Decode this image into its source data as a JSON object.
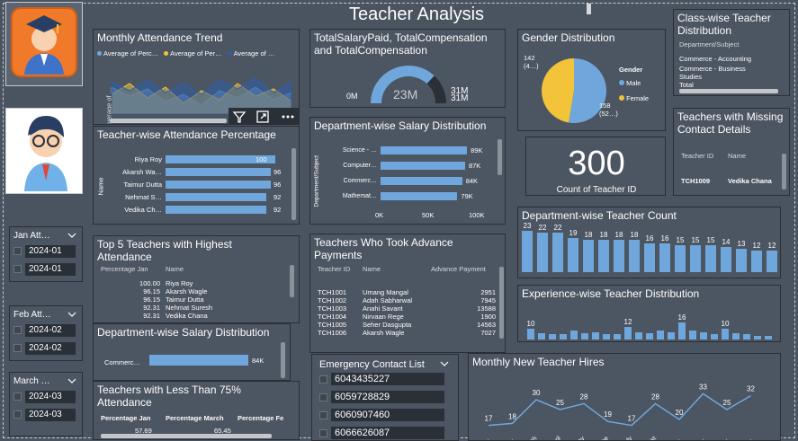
{
  "title": "Teacher Analysis",
  "colors": {
    "blue": "#6fa7dd",
    "yellow": "#f3c33a",
    "dark": "#2a3038",
    "gauge": "#6fa7dd"
  },
  "attendance": {
    "title": "Monthly Attendance Trend",
    "legend": [
      "Average of Perc…",
      "Average of Per…",
      "Average of …"
    ],
    "ylabel": "Average of …"
  },
  "salarypaid": {
    "title": "TotalSalaryPaid, TotalCompensation and TotalCompensation",
    "min": "0M",
    "val": "23M",
    "max1": "31M",
    "max2": "31M",
    "fraction": 0.74
  },
  "gender": {
    "title": "Gender Distribution",
    "legend_title": "Gender",
    "items": [
      {
        "name": "Male",
        "count": "158",
        "pct": "(52…)",
        "value": 158
      },
      {
        "name": "Female",
        "count": "142",
        "pct": "(4…)",
        "value": 142
      }
    ]
  },
  "classwise": {
    "title": "Class-wise Teacher Distribution",
    "header": "Department/Subject",
    "rows": [
      "Commerce - Accounting",
      "Commerce - Business Studies"
    ],
    "total": "Total"
  },
  "teacherwise": {
    "title": "Teacher-wise Attendance Percentage",
    "axis": "Name",
    "rows": [
      {
        "name": "Riya Roy",
        "value": 100,
        "label": "100"
      },
      {
        "name": "Akarsh Wa…",
        "value": 96,
        "label": "96"
      },
      {
        "name": "Taimur Dutta",
        "value": 96,
        "label": "96"
      },
      {
        "name": "Nehmat S…",
        "value": 92,
        "label": "92"
      },
      {
        "name": "Vedika Ch…",
        "value": 92,
        "label": "92"
      }
    ]
  },
  "deptsalary": {
    "title": "Department-wise Salary Distribution",
    "axis": "Department/Subject",
    "rows": [
      {
        "name": "Science - …",
        "value": 89,
        "label": "89K"
      },
      {
        "name": "Computer…",
        "value": 87,
        "label": "87K"
      },
      {
        "name": "Commerc…",
        "value": 84,
        "label": "84K"
      },
      {
        "name": "Mathemat…",
        "value": 79,
        "label": "79K"
      }
    ],
    "ticks": [
      "0K",
      "50K",
      "100K"
    ]
  },
  "count": {
    "value": "300",
    "label": "Count of Teacher ID"
  },
  "missing": {
    "title": "Teachers with Missing Contact Details",
    "h1": "Teacher ID",
    "h2": "Name",
    "rows": [
      {
        "id": "TCH1009",
        "name": "Vedika Chana"
      }
    ]
  },
  "top5": {
    "title": "Top 5 Teachers with Highest Attendance",
    "h1": "Percentage Jan",
    "h2": "Name",
    "rows": [
      {
        "p": "100.00",
        "n": "Riya Roy"
      },
      {
        "p": "96.15",
        "n": "Akarsh Wagle"
      },
      {
        "p": "96.15",
        "n": "Taimur Dutta"
      },
      {
        "p": "92.31",
        "n": "Nehmat Suresh"
      },
      {
        "p": "92.31",
        "n": "Vedika Chana"
      }
    ]
  },
  "advance": {
    "title": "Teachers Who Took Advance Payments",
    "h1": "Teacher ID",
    "h2": "Name",
    "h3": "Advance Payment",
    "rows": [
      {
        "id": "TCH1001",
        "n": "Umang Mangal",
        "v": "2951"
      },
      {
        "id": "TCH1002",
        "n": "Adah Sabharwal",
        "v": "7945"
      },
      {
        "id": "TCH1003",
        "n": "Anahi Savant",
        "v": "13588"
      },
      {
        "id": "TCH1004",
        "n": "Nirvaan Rege",
        "v": "1900"
      },
      {
        "id": "TCH1005",
        "n": "Seher Dasgupta",
        "v": "14563"
      },
      {
        "id": "TCH1006",
        "n": "Akarsh Wagle",
        "v": "7027"
      }
    ]
  },
  "deptcount": {
    "title": "Department-wise Teacher Count",
    "values": [
      23,
      22,
      22,
      19,
      18,
      18,
      18,
      18,
      16,
      16,
      15,
      15,
      15,
      14,
      13,
      12,
      12
    ]
  },
  "experience": {
    "title": "Experience-wise Teacher Distribution",
    "values": [
      10,
      6,
      5,
      5,
      8,
      6,
      7,
      5,
      5,
      12,
      7,
      6,
      8,
      7,
      16,
      8,
      7,
      5,
      10,
      6,
      5,
      3,
      3
    ],
    "labels": {
      "0": "10",
      "9": "12",
      "14": "16",
      "18": "10"
    }
  },
  "deptsalary2": {
    "title": "Department-wise Salary Distribution",
    "row": "Commerc…",
    "label": "84K",
    "value": 84
  },
  "lessthan": {
    "title": "Teachers with Less Than 75% Attendance",
    "h1": "Percentage Jan",
    "h2": "Percentage March",
    "h3": "Percentage Fe",
    "r1": "57.69",
    "r2": "65.45"
  },
  "emergency": {
    "title": "Emergency Contact List",
    "items": [
      "6043435227",
      "6059728829",
      "6060907460",
      "6066626087"
    ]
  },
  "hires": {
    "title": "Monthly New Teacher Hires",
    "months": [
      "Janu…",
      "Febr…",
      "March",
      "April",
      "May",
      "June",
      "July",
      "August",
      "Sept…",
      "Octo…",
      "Nove…",
      "Dece…"
    ],
    "values": [
      17,
      18,
      30,
      25,
      28,
      19,
      17,
      28,
      20,
      33,
      25,
      32
    ]
  },
  "slicers": [
    {
      "label": "Jan Att…",
      "v1": "2024-01",
      "v2": "2024-01"
    },
    {
      "label": "Feb Att…",
      "v1": "2024-02",
      "v2": "2024-02"
    },
    {
      "label": "March …",
      "v1": "2024-03",
      "v2": "2024-03"
    }
  ]
}
